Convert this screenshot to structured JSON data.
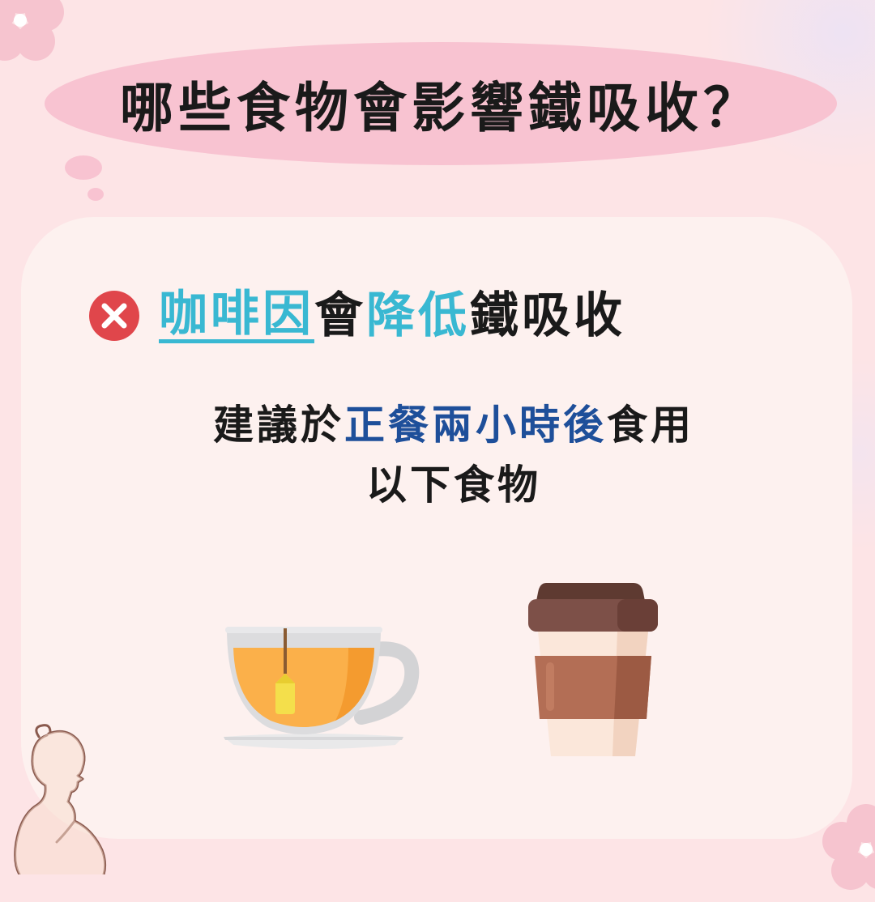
{
  "title": "哪些食物會影響鐵吸收？",
  "headline": {
    "caffeine": "咖啡因",
    "will": "會",
    "reduce": "降低",
    "rest": "鐵吸收"
  },
  "advice": {
    "prefix": "建議於",
    "highlight": "正餐兩小時後",
    "suffix": "食用",
    "line2": "以下食物"
  },
  "icons": {
    "status": "x-circle-icon",
    "tea": "tea-cup-icon",
    "coffee": "coffee-cup-icon",
    "person": "pregnant-woman-icon",
    "flower": "flower-icon"
  },
  "colors": {
    "background": "#fde4e6",
    "title_bubble": "#f8c3d1",
    "card": "#fdf1ef",
    "accent_cyan": "#39b8d2",
    "accent_blue": "#1e4f9a",
    "x_red": "#e0464b"
  }
}
